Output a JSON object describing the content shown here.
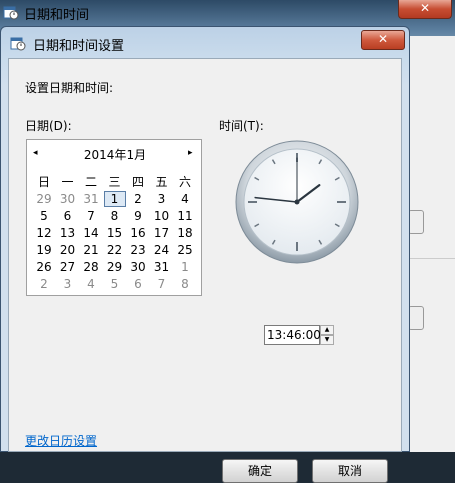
{
  "background_window": {
    "title": "日期和时间",
    "close_symbol": "✕"
  },
  "dialog": {
    "title": "日期和时间设置",
    "close_symbol": "✕",
    "set_label": "设置日期和时间:",
    "date_label": "日期(D):",
    "time_label": "时间(T):",
    "change_calendar_link": "更改日历设置",
    "ok_label": "确定",
    "cancel_label": "取消"
  },
  "calendar": {
    "prev_symbol": "◂",
    "next_symbol": "▸",
    "month_title": "2014年1月",
    "weekdays": [
      "日",
      "一",
      "二",
      "三",
      "四",
      "五",
      "六"
    ],
    "weeks": [
      [
        {
          "d": "29",
          "o": true
        },
        {
          "d": "30",
          "o": true
        },
        {
          "d": "31",
          "o": true
        },
        {
          "d": "1",
          "s": true
        },
        {
          "d": "2"
        },
        {
          "d": "3"
        },
        {
          "d": "4"
        }
      ],
      [
        {
          "d": "5"
        },
        {
          "d": "6"
        },
        {
          "d": "7"
        },
        {
          "d": "8"
        },
        {
          "d": "9"
        },
        {
          "d": "10"
        },
        {
          "d": "11"
        }
      ],
      [
        {
          "d": "12"
        },
        {
          "d": "13"
        },
        {
          "d": "14"
        },
        {
          "d": "15"
        },
        {
          "d": "16"
        },
        {
          "d": "17"
        },
        {
          "d": "18"
        }
      ],
      [
        {
          "d": "19"
        },
        {
          "d": "20"
        },
        {
          "d": "21"
        },
        {
          "d": "22"
        },
        {
          "d": "23"
        },
        {
          "d": "24"
        },
        {
          "d": "25"
        }
      ],
      [
        {
          "d": "26"
        },
        {
          "d": "27"
        },
        {
          "d": "28"
        },
        {
          "d": "29"
        },
        {
          "d": "30"
        },
        {
          "d": "31"
        },
        {
          "d": "1",
          "o": true
        }
      ],
      [
        {
          "d": "2",
          "o": true
        },
        {
          "d": "3",
          "o": true
        },
        {
          "d": "4",
          "o": true
        },
        {
          "d": "5",
          "o": true
        },
        {
          "d": "6",
          "o": true
        },
        {
          "d": "7",
          "o": true
        },
        {
          "d": "8",
          "o": true
        }
      ]
    ]
  },
  "time": {
    "value": "13:46:00",
    "hour": 13,
    "minute": 46,
    "second": 0,
    "spin_up": "▲",
    "spin_down": "▼"
  },
  "colors": {
    "link": "#0066cc",
    "selected_day_border": "#5a7ea6",
    "other_month_text": "#8a8a8a"
  }
}
